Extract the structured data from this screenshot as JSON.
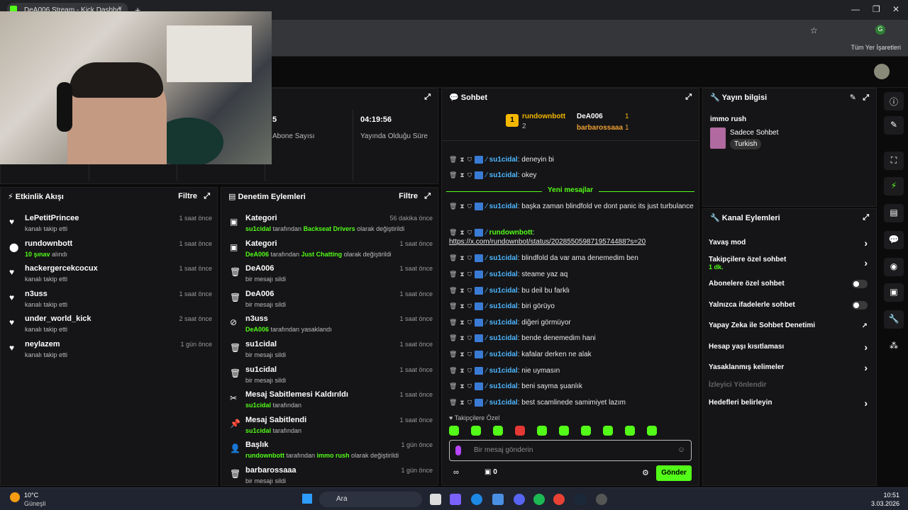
{
  "browser": {
    "tab_title": "DeA006 Stream - Kick Dashbo",
    "tab_close": "×",
    "new_tab": "+",
    "bookmarks_label": "Tüm Yer İşaretleri",
    "win_min": "—",
    "win_max": "❐",
    "win_close": "✕"
  },
  "stats": {
    "subs_value": "5",
    "subs_label": "Abone Sayısı",
    "uptime_value": "04:19:56",
    "uptime_label": "Yayında Olduğu Süre"
  },
  "activity": {
    "title": "Etkinlik Akışı",
    "filter": "Filtre",
    "items": [
      {
        "name": "LePetitPrincee",
        "sub": "kanalı takip etti",
        "time": "1 saat önce",
        "icon": "♥"
      },
      {
        "name": "rundownbott",
        "sub": "10 şınav",
        "sub2": " alındı",
        "time": "1 saat önce",
        "icon": "⬤"
      },
      {
        "name": "hackergercekcocux",
        "sub": "kanalı takip etti",
        "time": "1 saat önce",
        "icon": "♥"
      },
      {
        "name": "n3uss",
        "sub": "kanalı takip etti",
        "time": "1 saat önce",
        "icon": "♥"
      },
      {
        "name": "under_world_kick",
        "sub": "kanalı takip etti",
        "time": "2 saat önce",
        "icon": "♥"
      },
      {
        "name": "neylazem",
        "sub": "kanalı takip etti",
        "time": "1 gün önce",
        "icon": "♥"
      }
    ]
  },
  "modlog": {
    "title": "Denetim Eylemleri",
    "filter": "Filtre",
    "items": [
      {
        "name": "Kategori",
        "a": "su1cidal",
        "b": " tarafından ",
        "c": "Backseat Drivers",
        "d": " olarak değiştirildi",
        "time": "56 dakika önce",
        "icon": "▣"
      },
      {
        "name": "Kategori",
        "a": "DeA006",
        "b": " tarafından ",
        "c": "Just Chatting",
        "d": " olarak değiştirildi",
        "time": "1 saat önce",
        "icon": "▣"
      },
      {
        "name": "DeA006",
        "a": "",
        "b": "bir mesajı sildi",
        "c": "",
        "d": "",
        "time": "1 saat önce",
        "icon": "🗑"
      },
      {
        "name": "DeA006",
        "a": "",
        "b": "bir mesajı sildi",
        "c": "",
        "d": "",
        "time": "1 saat önce",
        "icon": "🗑"
      },
      {
        "name": "n3uss",
        "a": "DeA006",
        "b": " tarafından yasaklandı",
        "c": "",
        "d": "",
        "time": "1 saat önce",
        "icon": "⊘"
      },
      {
        "name": "su1cidal",
        "a": "",
        "b": "bir mesajı sildi",
        "c": "",
        "d": "",
        "time": "1 saat önce",
        "icon": "🗑"
      },
      {
        "name": "su1cidal",
        "a": "",
        "b": "bir mesajı sildi",
        "c": "",
        "d": "",
        "time": "1 saat önce",
        "icon": "🗑"
      },
      {
        "name": "Mesaj Sabitlemesi Kaldırıldı",
        "a": "su1cidal",
        "b": " tarafından",
        "c": "",
        "d": "",
        "time": "1 saat önce",
        "icon": "✂"
      },
      {
        "name": "Mesaj Sabitlendi",
        "a": "su1cidal",
        "b": " tarafından",
        "c": "",
        "d": "",
        "time": "1 saat önce",
        "icon": "📌"
      },
      {
        "name": "Başlık",
        "a": "rundownbott",
        "b": " tarafından ",
        "c": "immo rush",
        "d": " olarak değiştirildi",
        "time": "1 gün önce",
        "icon": "👤"
      },
      {
        "name": "barbarossaaa",
        "a": "",
        "b": "bir mesajı sildi",
        "c": "",
        "d": "",
        "time": "1 gün önce",
        "icon": "🗑"
      }
    ]
  },
  "chat": {
    "title": "Sohbet",
    "top": {
      "first_name": "rundownbott",
      "first_rank": "1",
      "first_count": "2",
      "second_name": "DeA006",
      "second_count": "1",
      "third_name": "barbarossaaa",
      "third_count": "1"
    },
    "new_messages": "Yeni mesajlar",
    "messages_before": [
      {
        "user": "su1cidal",
        "text": ": deneyin bi"
      },
      {
        "user": "su1cidal",
        "text": ": okey"
      }
    ],
    "messages_after": [
      {
        "user": "su1cidal",
        "text": ": başka zaman blindfold ve dont panic its just turbulance"
      },
      {
        "user": "rundownbott",
        "text": ":",
        "link": "https://x.com/rundownbot/status/2028550598719574488?s=20"
      },
      {
        "user": "su1cidal",
        "text": ": blindfold da var ama denemedim ben"
      },
      {
        "user": "su1cidal",
        "text": ": steame yaz aq"
      },
      {
        "user": "su1cidal",
        "text": ": bu deil bu farklı"
      },
      {
        "user": "su1cidal",
        "text": ": biri görüyo"
      },
      {
        "user": "su1cidal",
        "text": ": diğeri görmüyor"
      },
      {
        "user": "su1cidal",
        "text": ": bende denemedim hani"
      },
      {
        "user": "su1cidal",
        "text": ": kafalar derken ne alak"
      },
      {
        "user": "su1cidal",
        "text": ": nie uymasın"
      },
      {
        "user": "su1cidal",
        "text": ": beni sayma şuanlık"
      },
      {
        "user": "su1cidal",
        "text": ": best scamlinede samimiyet lazım"
      }
    ],
    "followers_only": "Takipçilere Özel",
    "input_placeholder": "Bir mesaj gönderin",
    "points": "0",
    "send": "Gönder"
  },
  "stream_info": {
    "title": "Yayın bilgisi",
    "stream_title": "immo rush",
    "category": "Sadece Sohbet",
    "language": "Turkish"
  },
  "channel_actions": {
    "title": "Kanal Eylemleri",
    "slow_mode": "Yavaş mod",
    "followers_chat": "Takipçilere özel sohbet",
    "followers_chat_sub": "1 dk.",
    "subs_chat": "Abonelere özel sohbet",
    "emote_chat": "Yalnızca ifadelerle sohbet",
    "ai_mod": "Yapay Zeka ile Sohbet Denetimi",
    "age_limits": "Hesap yaşı kısıtlaması",
    "banned_words": "Yasaklanmış kelimeler",
    "viewer_redirect": "İzleyici Yönlendir",
    "goals": "Hedefleri belirleyin"
  },
  "taskbar": {
    "weather_temp": "10°C",
    "weather_desc": "Güneşli",
    "search": "Ara",
    "time": "10:51",
    "date": "3.03.2026"
  }
}
